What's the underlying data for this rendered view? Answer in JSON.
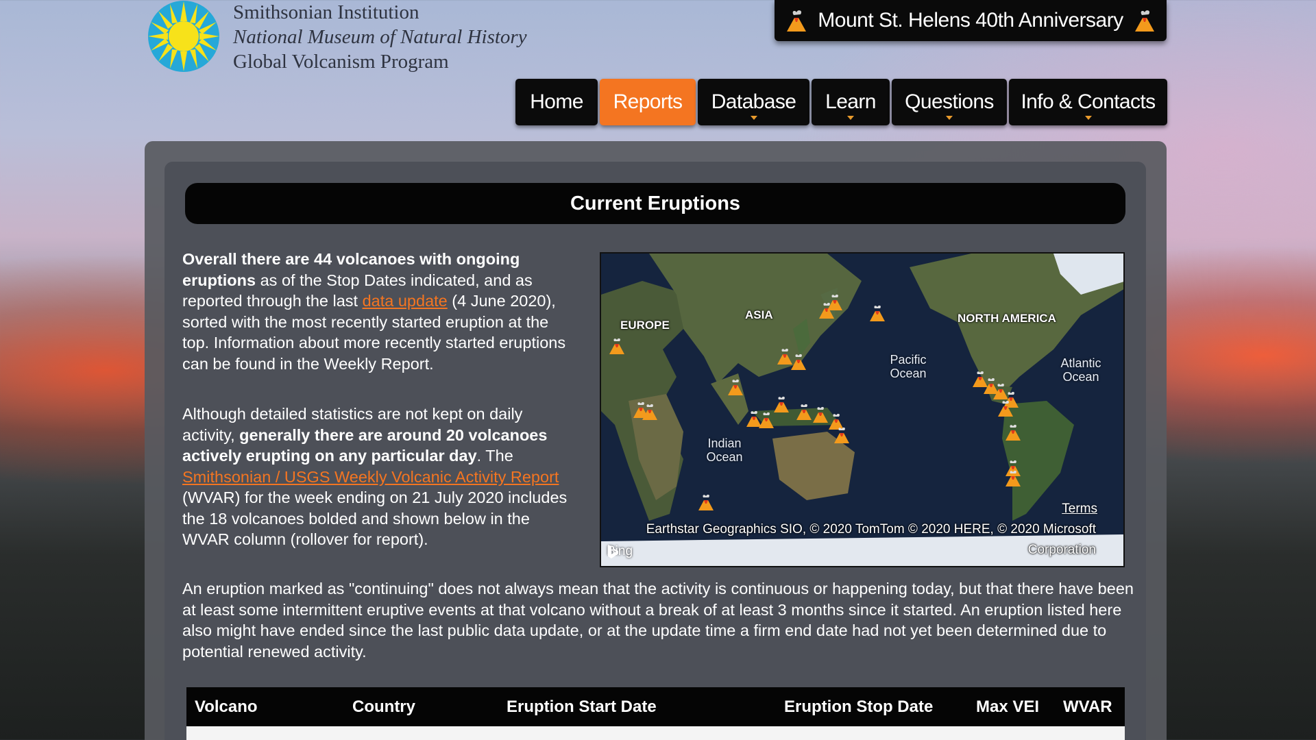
{
  "header": {
    "org_line1": "Smithsonian Institution",
    "org_line2": "National Museum of Natural History",
    "org_line3": "Global Volcanism Program",
    "anniversary": "Mount St. Helens 40th Anniversary"
  },
  "nav": {
    "items": [
      {
        "label": "Home",
        "dropdown": false,
        "active": false
      },
      {
        "label": "Reports",
        "dropdown": false,
        "active": true
      },
      {
        "label": "Database",
        "dropdown": true,
        "active": false
      },
      {
        "label": "Learn",
        "dropdown": true,
        "active": false
      },
      {
        "label": "Questions",
        "dropdown": true,
        "active": false
      },
      {
        "label": "Info & Contacts",
        "dropdown": true,
        "active": false
      }
    ]
  },
  "main": {
    "title": "Current Eruptions",
    "p1": {
      "bold": "Overall there are 44 volcanoes with ongoing eruptions",
      "t1": " as of the Stop Dates indicated, and as reported through the last ",
      "link": "data update",
      "t2": " (4 June 2020), sorted with the most recently started eruption at the top. Information about more recently started eruptions can be found in the Weekly Report."
    },
    "p2": {
      "t1": "Although detailed statistics are not kept on daily activity, ",
      "bold": "generally there are around 20 volcanoes actively erupting on any particular day",
      "t2": ". The ",
      "link": "Smithsonian / USGS Weekly Volcanic Activity Report",
      "t3": " (WVAR) for the week ending on 21 July 2020 includes the 18 volcanoes bolded and shown below in the WVAR column (rollover for report)."
    },
    "p3": "An eruption marked as \"continuing\" does not always mean that the activity is continuous or happening today, but that there have been at least some intermittent eruptive events at that volcano without a break of at least 3 months since it started. An eruption listed here also might have ended since the last public data update, or at the update time a firm end date had not yet been determined due to potential renewed activity."
  },
  "map": {
    "labels": {
      "europe": "EUROPE",
      "asia": "ASIA",
      "north_america": "NORTH AMERICA",
      "pacific": "Pacific Ocean",
      "atlantic": "Atlantic Ocean",
      "indian": "Indian Ocean"
    },
    "attribution": "Earthstar Geographics SIO, © 2020 TomTom © 2020 HERE, © 2020 Microsoft Corporation",
    "terms": "Terms",
    "bing": "Bing"
  },
  "table": {
    "headers": [
      "Volcano",
      "Country",
      "Eruption Start Date",
      "Eruption Stop Date",
      "Max VEI",
      "WVAR"
    ]
  },
  "colors": {
    "accent": "#f47521",
    "nav_bg": "#0b0b0b",
    "panel": "#4d5058"
  }
}
